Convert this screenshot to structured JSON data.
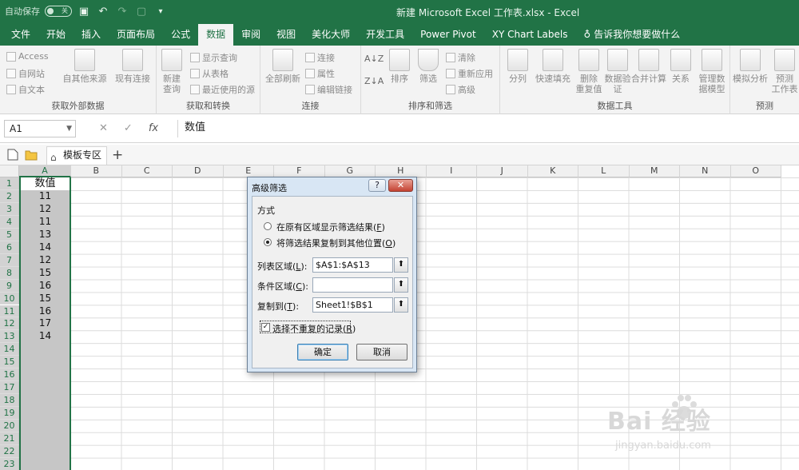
{
  "titlebar": {
    "autosave_label": "自动保存",
    "autosave_state": "关",
    "title": "新建 Microsoft Excel 工作表.xlsx  -  Excel"
  },
  "tabs": [
    "文件",
    "开始",
    "插入",
    "页面布局",
    "公式",
    "数据",
    "审阅",
    "视图",
    "美化大师",
    "开发工具",
    "Power Pivot",
    "XY Chart Labels"
  ],
  "active_tab": "数据",
  "tell_me": "告诉我你想要做什么",
  "ribbon": {
    "get_external": {
      "label": "获取外部数据",
      "access": "Access",
      "web": "自网站",
      "text": "自文本",
      "other": "自其他来源",
      "existing": "现有连接"
    },
    "get_transform": {
      "label": "获取和转换",
      "new_query_1": "新建",
      "new_query_2": "查询",
      "show_queries": "显示查询",
      "from_table": "从表格",
      "recent_sources": "最近使用的源"
    },
    "connections": {
      "label": "连接",
      "refresh_all": "全部刷新",
      "connections": "连接",
      "properties": "属性",
      "edit_links": "编辑链接"
    },
    "sort_filter": {
      "label": "排序和筛选",
      "sort": "排序",
      "filter": "筛选",
      "clear": "清除",
      "reapply": "重新应用",
      "advanced": "高级"
    },
    "data_tools": {
      "label": "数据工具",
      "split": "分列",
      "flash_fill": "快速填充",
      "remove_dup_1": "删除",
      "remove_dup_2": "重复值",
      "validation_1": "数据验",
      "validation_2": "证",
      "consolidate": "合并计算",
      "relations": "关系",
      "manage_model_1": "管理数",
      "manage_model_2": "据模型"
    },
    "forecast": {
      "label": "预测",
      "whatif": "模拟分析",
      "sheet_1": "预测",
      "sheet_2": "工作表"
    }
  },
  "formula_bar": {
    "namebox": "A1",
    "cancel_glyph": "✕",
    "enter_glyph": "✓",
    "fx_glyph": "fx",
    "value": "数值"
  },
  "doc_tabs": {
    "template_tab": "模板专区",
    "add": "+"
  },
  "columns": [
    "A",
    "B",
    "C",
    "D",
    "E",
    "F",
    "G",
    "H",
    "I",
    "J",
    "K",
    "L",
    "M",
    "N",
    "O"
  ],
  "rows": [
    "1",
    "2",
    "3",
    "4",
    "5",
    "6",
    "7",
    "8",
    "9",
    "10",
    "11",
    "12",
    "13",
    "14",
    "15",
    "16",
    "17",
    "18",
    "19",
    "20",
    "21",
    "22",
    "23"
  ],
  "column_a": [
    "数值",
    "11",
    "12",
    "11",
    "13",
    "14",
    "12",
    "15",
    "16",
    "15",
    "16",
    "17",
    "14"
  ],
  "dialog": {
    "title": "高级筛选",
    "help": "?",
    "close": "✕",
    "section": "方式",
    "radio1": "在原有区域显示筛选结果(",
    "radio1_key": "F",
    "radio2": "将筛选结果复制到其他位置(",
    "radio2_key": "O",
    "list_range_label": "列表区域(",
    "list_range_key": "L",
    "list_range_value": "$A$1:$A$13",
    "criteria_label": "条件区域(",
    "criteria_key": "C",
    "criteria_value": "",
    "copy_to_label": "复制到(",
    "copy_to_key": "T",
    "copy_to_value": "Sheet1!$B$1",
    "unique_label": "选择不重复的记录(",
    "unique_key": "R",
    "ok": "确定",
    "cancel": "取消",
    "close_paren": ")",
    "colon": "):"
  },
  "watermark": {
    "brand": "Bai    经验",
    "url": "jingyan.baidu.com"
  },
  "colors": {
    "excel_green": "#217346",
    "dialog_frame": "#d8e6f4"
  }
}
